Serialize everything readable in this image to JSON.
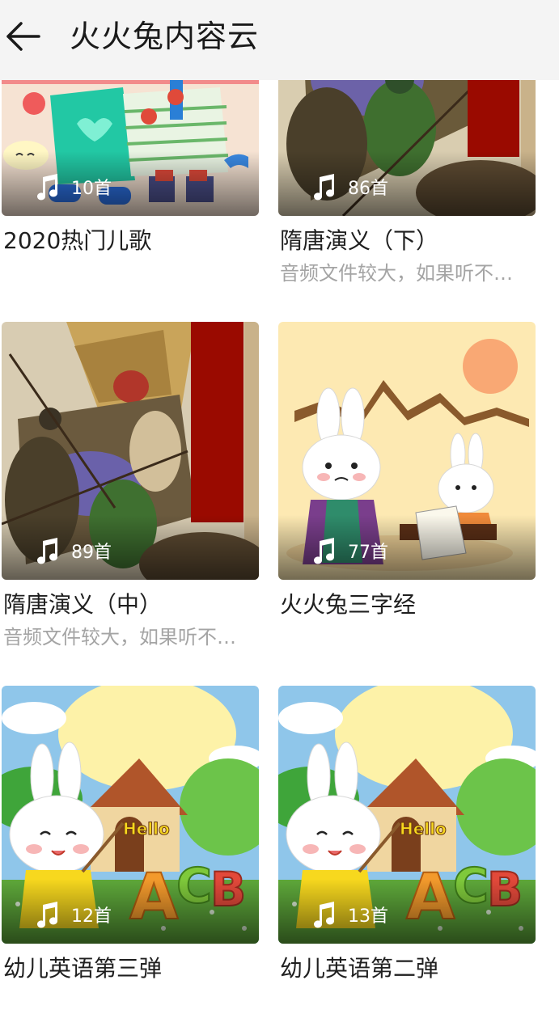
{
  "header": {
    "title": "火火兔内容云",
    "back_icon": "arrow-left-icon"
  },
  "icons": {
    "count_icon": "music-note-icon"
  },
  "albums": [
    {
      "title": "2020热门儿歌",
      "subtitle": "",
      "count": "10首",
      "art": "kids-song"
    },
    {
      "title": "隋唐演义（下）",
      "subtitle": "音频文件较大，如果听不…",
      "count": "86首",
      "art": "warriors"
    },
    {
      "title": "隋唐演义（中）",
      "subtitle": "音频文件较大，如果听不…",
      "count": "89首",
      "art": "warriors"
    },
    {
      "title": "火火兔三字经",
      "subtitle": "",
      "count": "77首",
      "art": "rabbit-classic"
    },
    {
      "title": "幼儿英语第三弹",
      "subtitle": "",
      "count": "12首",
      "art": "english"
    },
    {
      "title": "幼儿英语第二弹",
      "subtitle": "",
      "count": "13首",
      "art": "english"
    }
  ],
  "art_text": {
    "hello": "Hello",
    "letters": [
      "A",
      "C",
      "B"
    ]
  },
  "colors": {
    "header_bg": "#f4f4f4",
    "title_text": "#1f1f1f",
    "subtitle_text": "#a4a4a4",
    "accent_red": "#9a0a00"
  }
}
